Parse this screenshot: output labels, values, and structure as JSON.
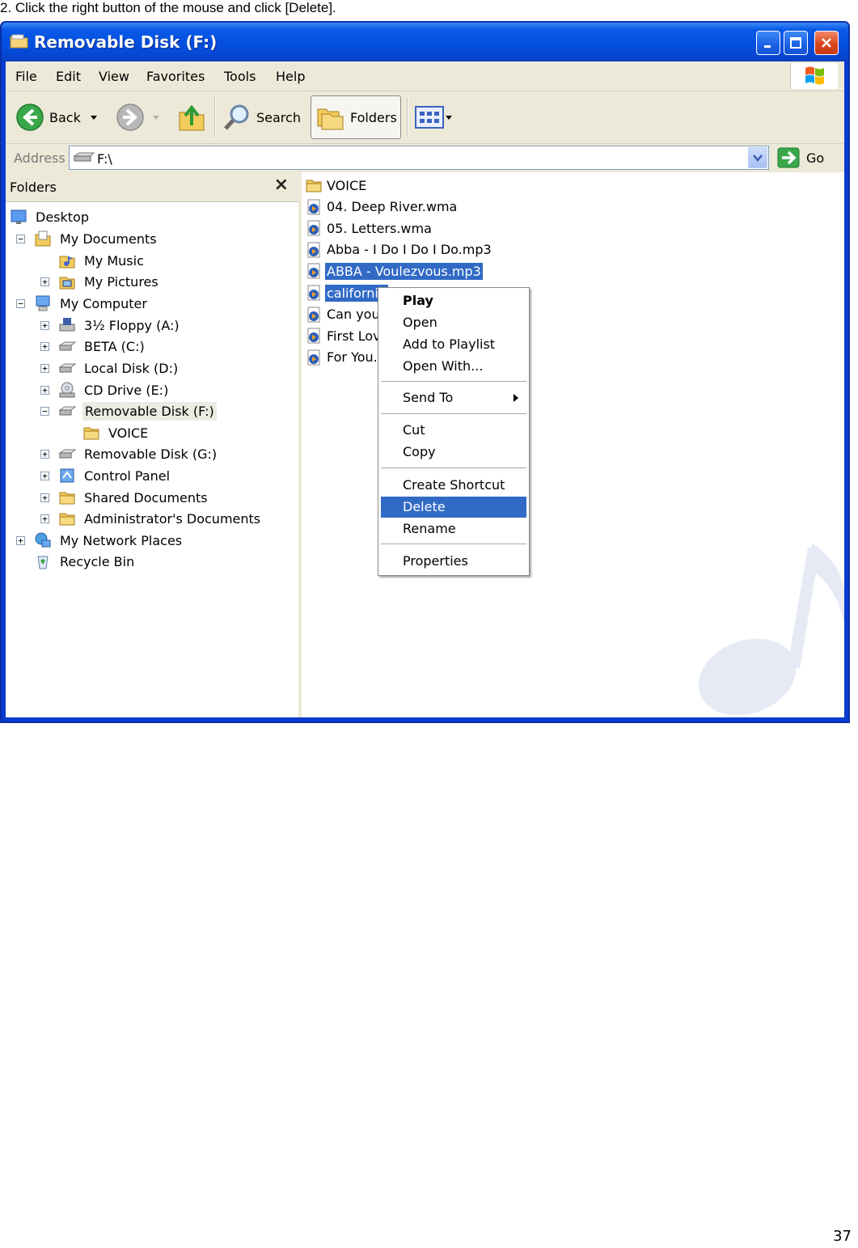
{
  "instruction": "2. Click the right button of the mouse and click [Delete].",
  "page_number": "37",
  "window": {
    "title": "Removable Disk (F:)",
    "menu": [
      "File",
      "Edit",
      "View",
      "Favorites",
      "Tools",
      "Help"
    ],
    "toolbar": {
      "back_label": "Back",
      "search_label": "Search",
      "folders_label": "Folders"
    },
    "address": {
      "label": "Address",
      "value": "F:\\",
      "go_label": "Go"
    }
  },
  "folders_pane": {
    "title": "Folders",
    "items": [
      {
        "label": "Desktop",
        "icon": "desktop-icon"
      },
      {
        "label": "My Documents",
        "icon": "my-documents-icon"
      },
      {
        "label": "My Music",
        "icon": "music-folder-icon"
      },
      {
        "label": "My Pictures",
        "icon": "pictures-folder-icon"
      },
      {
        "label": "My Computer",
        "icon": "my-computer-icon"
      },
      {
        "label": "3½ Floppy (A:)",
        "icon": "floppy-drive-icon"
      },
      {
        "label": "BETA (C:)",
        "icon": "hard-disk-icon"
      },
      {
        "label": "Local Disk (D:)",
        "icon": "hard-disk-icon"
      },
      {
        "label": "CD Drive (E:)",
        "icon": "cd-drive-icon"
      },
      {
        "label": "Removable Disk (F:)",
        "icon": "removable-disk-icon",
        "selected": true
      },
      {
        "label": "VOICE",
        "icon": "folder-icon"
      },
      {
        "label": "Removable Disk (G:)",
        "icon": "removable-disk-icon"
      },
      {
        "label": "Control Panel",
        "icon": "control-panel-icon"
      },
      {
        "label": "Shared Documents",
        "icon": "folder-icon"
      },
      {
        "label": "Administrator's Documents",
        "icon": "folder-icon"
      },
      {
        "label": "My Network Places",
        "icon": "network-places-icon"
      },
      {
        "label": "Recycle Bin",
        "icon": "recycle-bin-icon"
      }
    ]
  },
  "files": [
    {
      "label": "VOICE",
      "icon": "folder-icon"
    },
    {
      "label": "04. Deep River.wma",
      "icon": "media-file-icon"
    },
    {
      "label": "05. Letters.wma",
      "icon": "media-file-icon"
    },
    {
      "label": "Abba - I Do I Do I Do.mp3",
      "icon": "media-file-icon"
    },
    {
      "label": "ABBA - Voulezvous.mp3",
      "icon": "media-file-icon",
      "selected": true
    },
    {
      "label": "california",
      "icon": "media-file-icon",
      "selected": true
    },
    {
      "label": "Can you",
      "icon": "media-file-icon"
    },
    {
      "label": "First Lov",
      "icon": "media-file-icon"
    },
    {
      "label": "For You.",
      "icon": "media-file-icon"
    }
  ],
  "context_menu": {
    "items": [
      "Play",
      "Open",
      "Add to Playlist",
      "Open With...",
      "Send To",
      "Cut",
      "Copy",
      "Create Shortcut",
      "Delete",
      "Rename",
      "Properties"
    ],
    "highlighted": "Delete"
  },
  "colors": {
    "selection": "#316ac5",
    "titlebar": "#0a5ae8",
    "window_face": "#ece9d8"
  }
}
